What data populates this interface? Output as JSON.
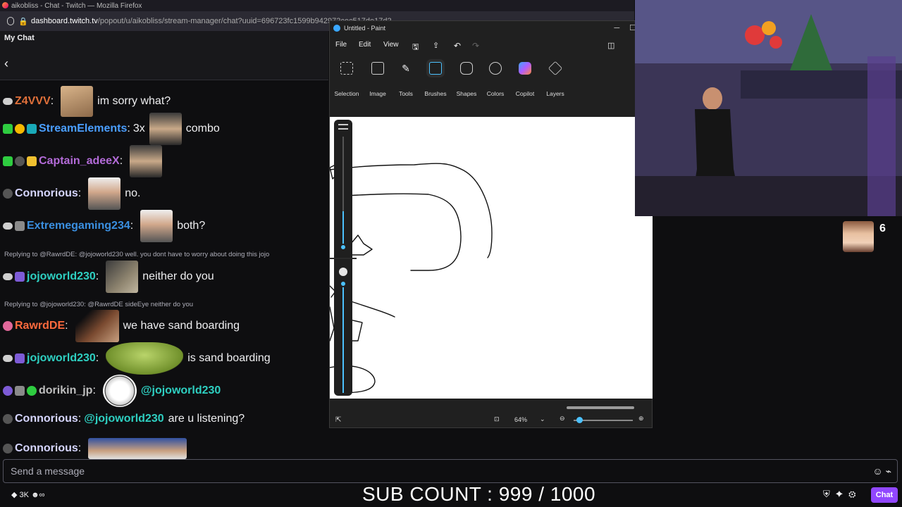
{
  "browser": {
    "title": "aikobliss - Chat - Twitch — Mozilla Firefox",
    "url_domain": "dashboard.twitch.tv",
    "url_path": "/popout/u/aikobliss/stream-manager/chat?uuid=696723fc1599b942972cec517de17d2"
  },
  "chat": {
    "header": "My Chat",
    "messages": [
      {
        "user": "Z4VVV",
        "text": "im sorry what?"
      },
      {
        "user": "StreamElements",
        "text": "3x",
        "suffix": "combo"
      },
      {
        "user": "Captain_adeeX",
        "text": ""
      },
      {
        "user": "Connorious",
        "text": "no."
      },
      {
        "user": "Extremegaming234",
        "text": "both?"
      },
      {
        "reply": "Replying to @RawrdDE: @jojoworld230 well. you dont have to worry about doing this jojo"
      },
      {
        "user": "jojoworld230",
        "text": "neither do you"
      },
      {
        "reply": "Replying to @jojoworld230: @RawrdDE sideEye neither do you"
      },
      {
        "user": "RawrdDE",
        "text": "we have sand boarding"
      },
      {
        "user": "jojoworld230",
        "text": "is sand boarding"
      },
      {
        "user": "dorikin_jp",
        "text": "@jojoworld230"
      },
      {
        "user": "Connorious",
        "mention": "@jojoworld230",
        "text": "are u listening?"
      },
      {
        "user": "Connorious",
        "text": ""
      }
    ],
    "input_placeholder": "Send a message",
    "points": "3K",
    "chat_button": "Chat"
  },
  "overlay": {
    "sub_count": "SUB COUNT : 999 / 1000",
    "viewer_count": "6"
  },
  "paint": {
    "title": "Untitled - Paint",
    "menu": [
      "File",
      "Edit",
      "View"
    ],
    "tools": [
      "Selection",
      "Image",
      "Tools",
      "Brushes",
      "Shapes",
      "Colors",
      "Copilot",
      "Layers"
    ],
    "zoom": "64%"
  },
  "colors": {
    "accent": "#9147ff",
    "z4vvv": "#e0703a",
    "streamelements": "#4a9eff",
    "captain": "#b36bd8",
    "connorious": "#d6d6ff",
    "extreme": "#3a8fe0",
    "jojo": "#2ecfc1",
    "rawrd": "#ff6a3d",
    "dorikin": "#bfbfbf",
    "mention": "#2ecfc1"
  }
}
